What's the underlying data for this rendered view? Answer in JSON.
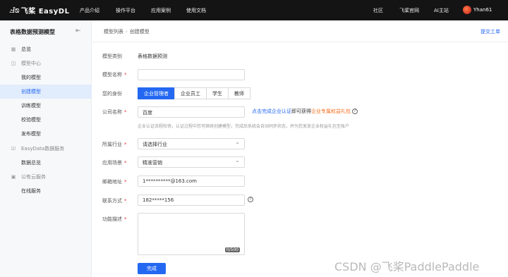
{
  "topbar": {
    "logo_mark": "Ⅎᴓ",
    "brand": "飞桨 EasyDL",
    "nav": [
      "产品介绍",
      "操作平台",
      "应用案例",
      "使用文档"
    ],
    "right_links": [
      "社区",
      "飞桨官网",
      "AI主站"
    ],
    "username": "Yhan61"
  },
  "sidebar": {
    "title": "表格数据预测模型",
    "collapse_icon": "collapse-icon",
    "items": [
      {
        "label": "总览",
        "icon": "grid-icon",
        "kind": "group"
      },
      {
        "label": "模型中心",
        "icon": "cube-icon",
        "kind": "group"
      },
      {
        "label": "我的模型",
        "kind": "sub"
      },
      {
        "label": "创建模型",
        "kind": "sub",
        "active": true
      },
      {
        "label": "训练模型",
        "kind": "sub"
      },
      {
        "label": "校验模型",
        "kind": "sub"
      },
      {
        "label": "发布模型",
        "kind": "sub"
      },
      {
        "label": "EasyData数据服务",
        "icon": "data-icon",
        "kind": "group"
      },
      {
        "label": "数据总览",
        "kind": "sub"
      },
      {
        "label": "公有云服务",
        "icon": "cloud-icon",
        "kind": "group"
      },
      {
        "label": "在线服务",
        "kind": "sub"
      }
    ]
  },
  "breadcrumb": {
    "parent": "模型列表",
    "separator": "›",
    "current": "创建模型"
  },
  "ticket_link": "提交工单",
  "form": {
    "model_type_label": "模型类别",
    "model_type_value": "表格数据预测",
    "model_name_label": "模型名称",
    "model_name_value": "",
    "identity_label": "您的身份",
    "identity_options": [
      "企业管理者",
      "企业员工",
      "学生",
      "教师"
    ],
    "identity_selected": "企业管理者",
    "company_label": "公司名称",
    "company_value": "百度",
    "verify_link": "点击完成企业认证",
    "verify_mid": "即可获得",
    "verify_gift": "企业专属权益礼包",
    "verify_note": "企业认证流程较快，认证过程中您可继续创建模型，完成后系统会自动同步状态，并为您发放企业权益礼包至账户",
    "industry_label": "所属行业",
    "industry_value": "请选择行业",
    "scenario_label": "应用场景",
    "scenario_value": "精准营销",
    "email_label": "邮箱地址",
    "email_value": "1**********@163.com",
    "phone_label": "联系方式",
    "phone_value": "182*****156",
    "desc_label": "功能描述",
    "desc_counter": "0/500",
    "submit_label": "完成",
    "required_mark": "*"
  },
  "watermark": "CSDN @飞桨PaddlePaddle"
}
